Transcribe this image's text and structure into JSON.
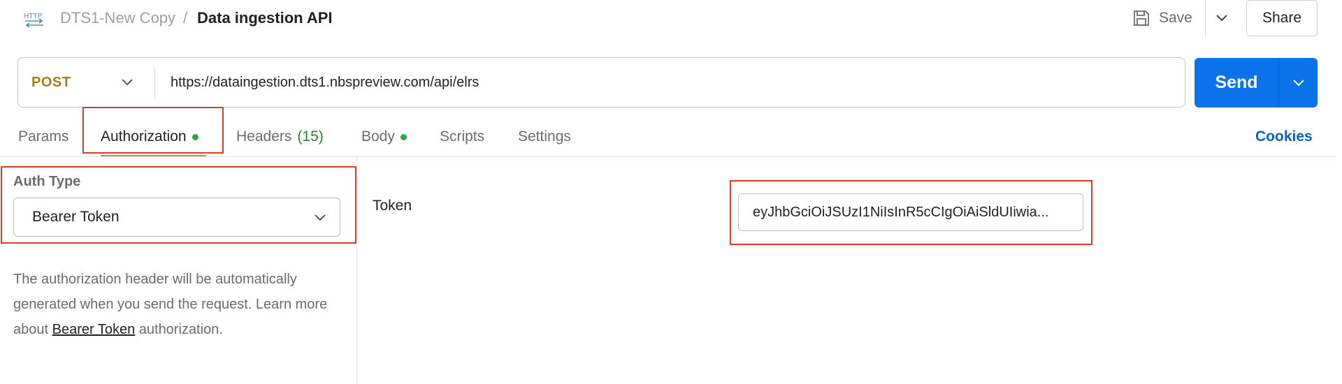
{
  "header": {
    "collection": "DTS1-New Copy",
    "separator": "/",
    "request_name": "Data ingestion API",
    "save_label": "Save",
    "share_label": "Share"
  },
  "request": {
    "method": "POST",
    "url": "https://dataingestion.dts1.nbspreview.com/api/elrs",
    "send_label": "Send"
  },
  "tabs": [
    {
      "label": "Params"
    },
    {
      "label": "Authorization",
      "active": true,
      "dot": true
    },
    {
      "label": "Headers",
      "count": "(15)"
    },
    {
      "label": "Body",
      "dot": true
    },
    {
      "label": "Scripts"
    },
    {
      "label": "Settings"
    }
  ],
  "cookies_label": "Cookies",
  "auth": {
    "type_label": "Auth Type",
    "type_value": "Bearer Token",
    "description_before": "The authorization header will be automatically generated when you send the request. Learn more about ",
    "description_link": "Bearer Token",
    "description_after": " authorization.",
    "token_label": "Token",
    "token_value": "eyJhbGciOiJSUzI1NiIsInR5cCIgOiAiSldUIiwia..."
  },
  "colors": {
    "method": "#a97c1e",
    "send": "#0b73ea",
    "highlight": "#dc3b27",
    "dot": "#28a745",
    "link": "#0b5fc2"
  }
}
